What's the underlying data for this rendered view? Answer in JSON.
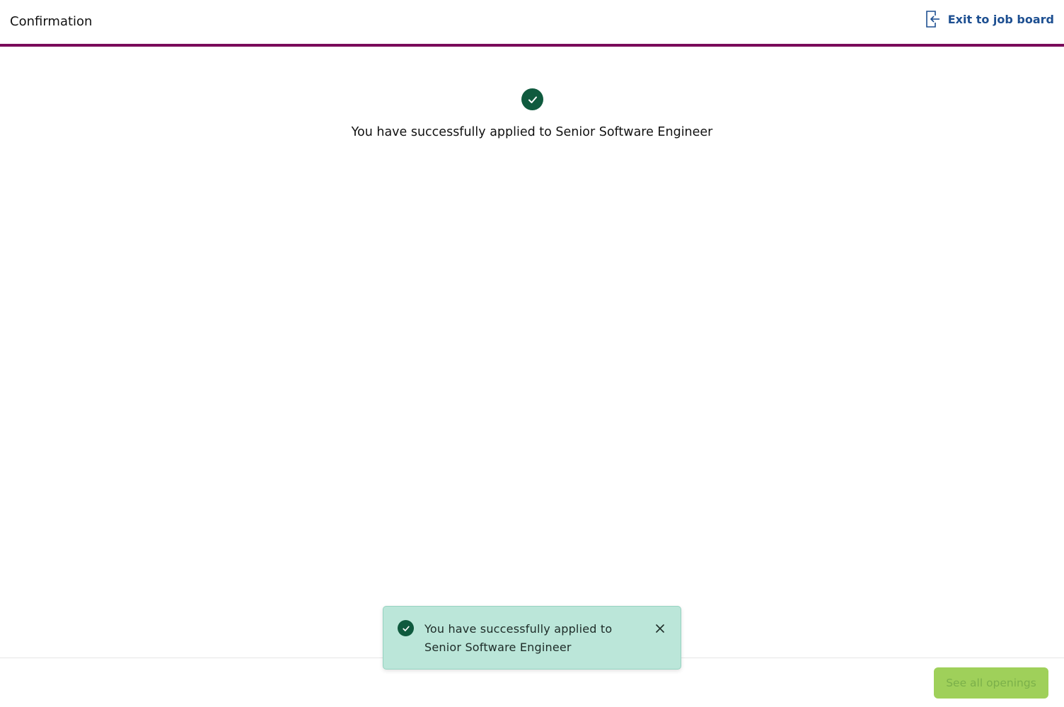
{
  "header": {
    "title": "Confirmation",
    "exit_label": "Exit to job board",
    "exit_icon": "exit-door-icon",
    "border_color": "#7a0a5a"
  },
  "main": {
    "status_icon": "check-circle-icon",
    "message": "You have successfully applied to Senior Software Engineer"
  },
  "toast": {
    "icon": "check-circle-icon",
    "message": "You have successfully applied to Senior Software Engineer",
    "close_icon": "close-icon",
    "background": "#bbe6d9"
  },
  "footer": {
    "see_all_label": "See all openings",
    "button_color": "#9fd05a"
  }
}
